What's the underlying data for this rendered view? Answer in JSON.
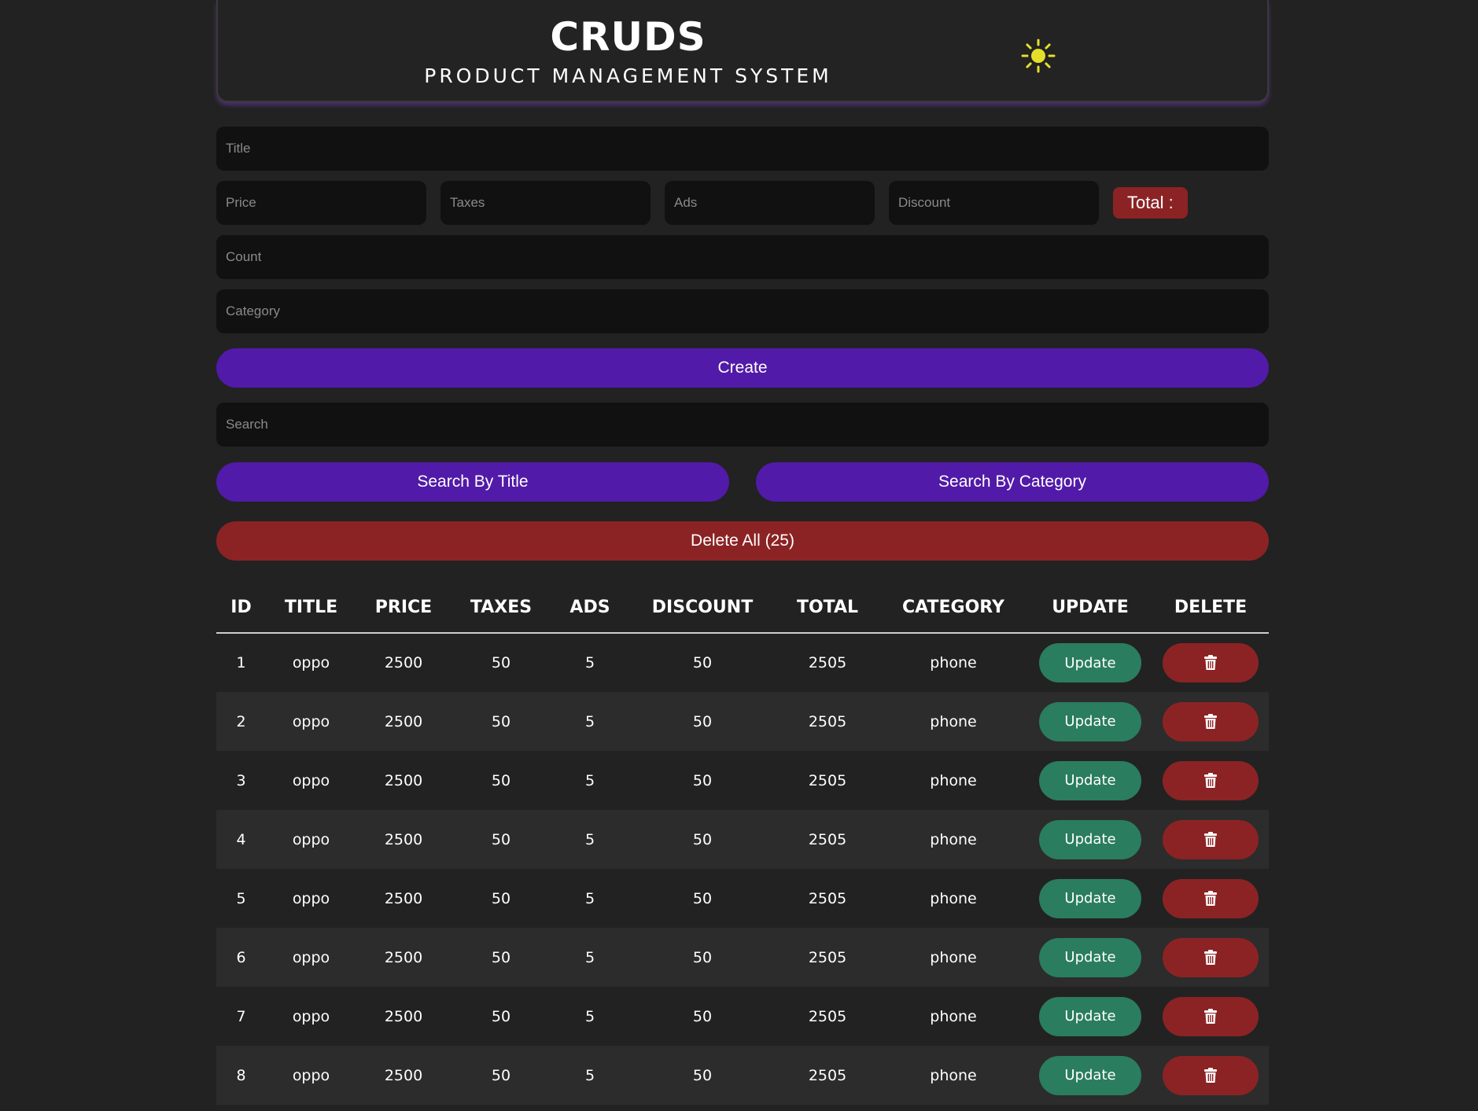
{
  "header": {
    "title": "CRUDS",
    "subtitle": "PRODUCT MANAGEMENT SYSTEM",
    "theme_icon": "sun-icon"
  },
  "form": {
    "title_placeholder": "Title",
    "price_placeholder": "Price",
    "taxes_placeholder": "Taxes",
    "ads_placeholder": "Ads",
    "discount_placeholder": "Discount",
    "total_label": "Total :",
    "count_placeholder": "Count",
    "category_placeholder": "Category",
    "create_label": "Create"
  },
  "search": {
    "placeholder": "Search",
    "by_title_label": "Search By Title",
    "by_category_label": "Search By Category"
  },
  "delete_all_label": "Delete All (25)",
  "table": {
    "headers": [
      "ID",
      "TITLE",
      "PRICE",
      "TAXES",
      "ADS",
      "DISCOUNT",
      "TOTAL",
      "CATEGORY",
      "UPDATE",
      "DELETE"
    ],
    "update_label": "Update",
    "delete_icon": "trash-icon",
    "rows": [
      {
        "id": "1",
        "title": "oppo",
        "price": "2500",
        "taxes": "50",
        "ads": "5",
        "discount": "50",
        "total": "2505",
        "category": "phone"
      },
      {
        "id": "2",
        "title": "oppo",
        "price": "2500",
        "taxes": "50",
        "ads": "5",
        "discount": "50",
        "total": "2505",
        "category": "phone"
      },
      {
        "id": "3",
        "title": "oppo",
        "price": "2500",
        "taxes": "50",
        "ads": "5",
        "discount": "50",
        "total": "2505",
        "category": "phone"
      },
      {
        "id": "4",
        "title": "oppo",
        "price": "2500",
        "taxes": "50",
        "ads": "5",
        "discount": "50",
        "total": "2505",
        "category": "phone"
      },
      {
        "id": "5",
        "title": "oppo",
        "price": "2500",
        "taxes": "50",
        "ads": "5",
        "discount": "50",
        "total": "2505",
        "category": "phone"
      },
      {
        "id": "6",
        "title": "oppo",
        "price": "2500",
        "taxes": "50",
        "ads": "5",
        "discount": "50",
        "total": "2505",
        "category": "phone"
      },
      {
        "id": "7",
        "title": "oppo",
        "price": "2500",
        "taxes": "50",
        "ads": "5",
        "discount": "50",
        "total": "2505",
        "category": "phone"
      },
      {
        "id": "8",
        "title": "oppo",
        "price": "2500",
        "taxes": "50",
        "ads": "5",
        "discount": "50",
        "total": "2505",
        "category": "phone"
      }
    ]
  },
  "colors": {
    "background": "#222222",
    "input": "#111111",
    "primary": "#521aa8",
    "danger": "#8b2324",
    "success": "#2a7d5e",
    "sun": "#e6df2a"
  }
}
